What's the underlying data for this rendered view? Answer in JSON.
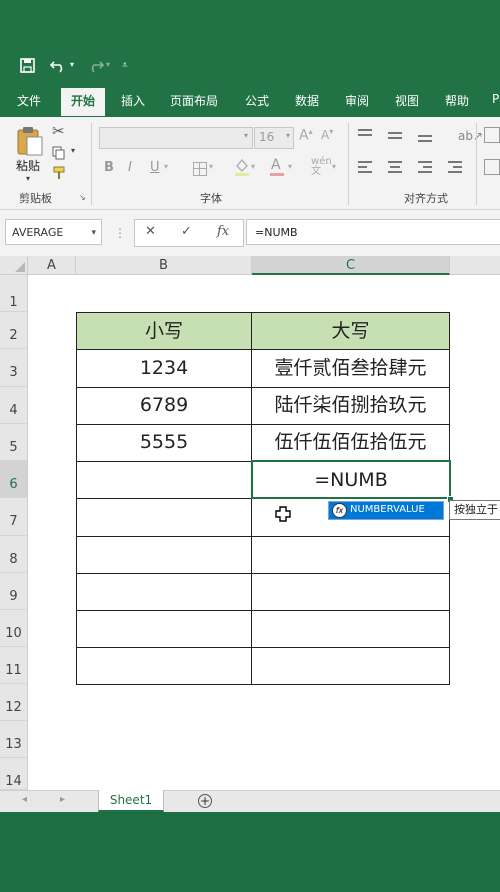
{
  "ribbon_tabs": [
    "文件",
    "开始",
    "插入",
    "页面布局",
    "公式",
    "数据",
    "审阅",
    "视图",
    "帮助",
    "P"
  ],
  "ribbon": {
    "paste_label": "粘贴",
    "group_clipboard": "剪贴板",
    "group_font": "字体",
    "group_align": "对齐方式",
    "font_size": "16"
  },
  "formula_bar": {
    "name_box": "AVERAGE",
    "formula": "=NUMB"
  },
  "columns": [
    "A",
    "B",
    "C"
  ],
  "rows": [
    "1",
    "2",
    "3",
    "4",
    "5",
    "6",
    "7",
    "8",
    "9",
    "10",
    "11",
    "12",
    "13",
    "14"
  ],
  "table": {
    "headers": [
      "小写",
      "大写"
    ],
    "rows": [
      [
        "1234",
        "壹仟贰佰叁拾肆元"
      ],
      [
        "6789",
        "陆仟柒佰捌拾玖元"
      ],
      [
        "5555",
        "伍仟伍佰伍拾伍元"
      ],
      [
        "",
        "=NUMB"
      ],
      [
        "",
        ""
      ],
      [
        "",
        ""
      ],
      [
        "",
        ""
      ],
      [
        "",
        ""
      ],
      [
        "",
        ""
      ]
    ]
  },
  "autocomplete": {
    "item": "NUMBERVALUE",
    "tooltip": "按独立于"
  },
  "sheet_tab": "Sheet1",
  "colors": {
    "excel_green": "#217346",
    "header_fill": "#c6e0b4",
    "selection_blue": "#0078d7"
  }
}
